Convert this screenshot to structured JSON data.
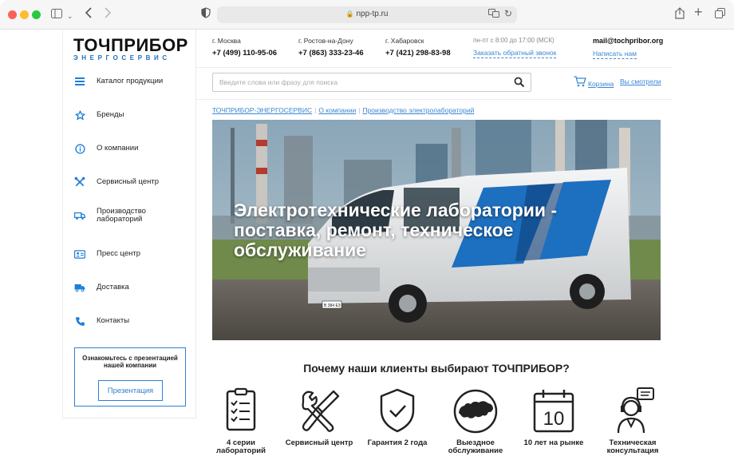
{
  "browser": {
    "url": "npp-tp.ru"
  },
  "logo": {
    "line1": "ТОЧПРИБОР",
    "line2": "ЭНЕРГОСЕРВИС"
  },
  "sidebar": {
    "items": [
      {
        "label": "Каталог продукции",
        "icon": "menu-icon"
      },
      {
        "label": "Бренды",
        "icon": "star-icon"
      },
      {
        "label": "О компании",
        "icon": "info-icon"
      },
      {
        "label": "Сервисный центр",
        "icon": "tools-icon"
      },
      {
        "label": "Производство лабораторий",
        "icon": "truck-icon"
      },
      {
        "label": "Пресс центр",
        "icon": "id-card-icon"
      },
      {
        "label": "Доставка",
        "icon": "delivery-icon"
      },
      {
        "label": "Контакты",
        "icon": "phone-icon"
      }
    ],
    "promo_text": "Ознакомьтесь с презентацией нашей компании",
    "promo_button": "Презентация"
  },
  "header": {
    "offices": [
      {
        "city": "г. Москва",
        "phone": "+7 (499) 110-95-06"
      },
      {
        "city": "г. Ростов-на-Дону",
        "phone": "+7 (863) 333-23-46"
      },
      {
        "city": "г. Хабаровск",
        "phone": "+7 (421) 298-83-98"
      }
    ],
    "hours": "пн-пт с 8:00 до 17:00 (МСК)",
    "callback": "Заказать обратный звонок",
    "email": "mail@tochpribor.org",
    "write_us": "Написать нам"
  },
  "search": {
    "placeholder": "Введите слова или фразу для поиска"
  },
  "cart": {
    "label": "Корзина"
  },
  "seen": {
    "label": "Вы смотрели"
  },
  "breadcrumbs": [
    "ТОЧПРИБОР-ЭНЕРГОСЕРВИС",
    "О компании",
    "Производство электролабораторий"
  ],
  "hero": {
    "title": "Электротехнические лаборатории - поставка, ремонт, техническое обслуживание",
    "plate": "В 384 ЕЗ"
  },
  "why": {
    "title": "Почему наши клиенты выбирают ТОЧПРИБОР?"
  },
  "features": [
    {
      "label": "4 серии лабораторий",
      "icon": "checklist-icon"
    },
    {
      "label": "Сервисный центр",
      "icon": "wrench-screwdriver-icon"
    },
    {
      "label": "Гарантия 2 года",
      "icon": "shield-check-icon"
    },
    {
      "label": "Выездное обслуживание",
      "icon": "russia-map-icon"
    },
    {
      "label": "10 лет на рынке",
      "icon": "calendar-icon",
      "number": "10"
    },
    {
      "label": "Техническая консультация",
      "icon": "support-agent-icon"
    }
  ],
  "colors": {
    "accent": "#1f7fd6",
    "link": "#3a86d3",
    "logo_text": "#111111"
  }
}
